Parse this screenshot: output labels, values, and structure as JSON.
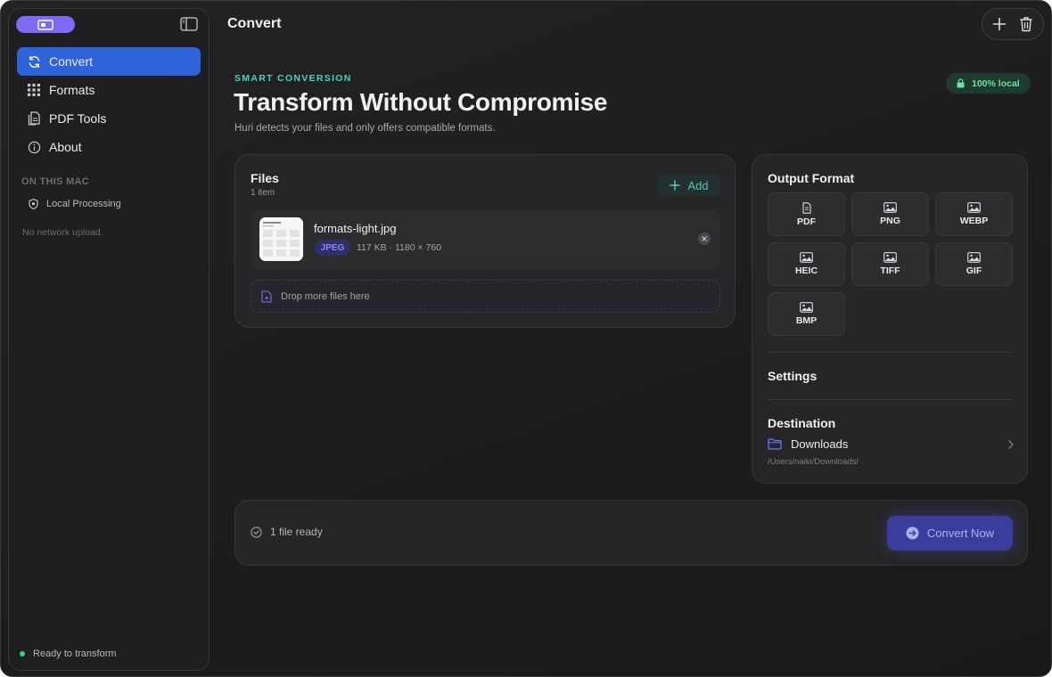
{
  "window": {
    "title": "Convert"
  },
  "sidebar": {
    "items": [
      {
        "label": "Convert",
        "icon": "refresh-icon",
        "active": true
      },
      {
        "label": "Formats",
        "icon": "grid-icon",
        "active": false
      },
      {
        "label": "PDF Tools",
        "icon": "document-icon",
        "active": false
      },
      {
        "label": "About",
        "icon": "info-icon",
        "active": false
      }
    ],
    "section_title": "ON THIS MAC",
    "local_processing": "Local Processing",
    "no_network": "No network upload.",
    "status": "Ready to transform"
  },
  "hero": {
    "eyebrow": "SMART CONVERSION",
    "headline": "Transform Without Compromise",
    "subline": "Huri detects your files and only offers compatible formats.",
    "local_badge": "100% local"
  },
  "files": {
    "title": "Files",
    "count": "1 item",
    "add_label": "Add",
    "items": [
      {
        "name": "formats-light.jpg",
        "type": "JPEG",
        "meta": "117 KB · 1180 × 760"
      }
    ],
    "drop_label": "Drop more files here"
  },
  "output": {
    "title": "Output Format",
    "formats": [
      "PDF",
      "PNG",
      "WEBP",
      "HEIC",
      "TIFF",
      "GIF",
      "BMP"
    ],
    "settings_title": "Settings",
    "destination_title": "Destination",
    "destination_folder": "Downloads",
    "destination_path": "/Users/naiki/Downloads/"
  },
  "footer": {
    "ready_text": "1 file ready",
    "convert_label": "Convert Now"
  },
  "colors": {
    "accent_blue": "#2f63d9",
    "accent_purple": "#7b6cf6",
    "teal": "#4fd1c5",
    "green": "#3ecf7e"
  }
}
